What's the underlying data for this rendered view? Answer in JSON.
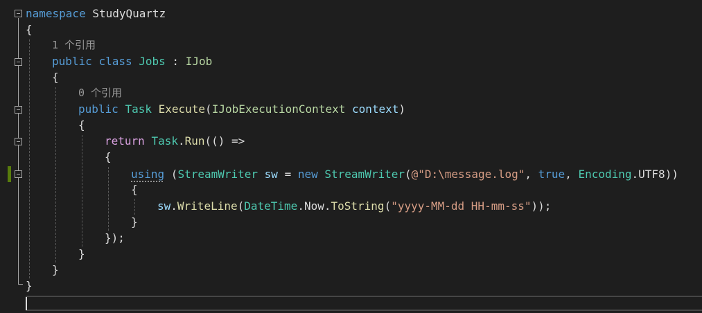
{
  "editor": {
    "language": "C#",
    "colors": {
      "background": "#1e1e1e",
      "keyword": "#569cd6",
      "control_keyword": "#d8a0df",
      "type": "#4ec9b0",
      "interface": "#b8d7a3",
      "method": "#dcdcaa",
      "parameter": "#9cdcfe",
      "string": "#d69d85",
      "codelens": "#999999",
      "change_marker": "#587c0c"
    },
    "lines": {
      "l1": {
        "kw": "namespace",
        "name": " StudyQuartz"
      },
      "l2": {
        "text": "{"
      },
      "l3": {
        "codelens": "1 个引用"
      },
      "l4": {
        "kw1": "public",
        "kw2": "class",
        "name": "Jobs",
        "sep": " : ",
        "iface": "IJob"
      },
      "l5": {
        "text": "{"
      },
      "l6": {
        "codelens": "0 个引用"
      },
      "l7": {
        "kw": "public",
        "type": "Task",
        "method": "Execute",
        "open": "(",
        "ptype": "IJobExecutionContext",
        "pname": "context",
        "close": ")"
      },
      "l8": {
        "text": "{"
      },
      "l9": {
        "kw": "return",
        "type": "Task",
        "dot": ".",
        "method": "Run",
        "rest": "(() =>"
      },
      "l10": {
        "text": "{"
      },
      "l11": {
        "kw": "using",
        "open": " (",
        "type1": "StreamWriter",
        "var": " sw",
        "eq": " = ",
        "kw_new": "new",
        "type2": "StreamWriter",
        "paren": "(",
        "str": "@\"D:\\message.log\"",
        "comma1": ", ",
        "kw_true": "true",
        "comma2": ", ",
        "type3": "Encoding",
        "prop": ".UTF8",
        "close": "))"
      },
      "l12": {
        "text": "{"
      },
      "l13": {
        "var": "sw",
        "dot1": ".",
        "method1": "WriteLine",
        "p1": "(",
        "type": "DateTime",
        "dot2": ".",
        "prop": "Now",
        "dot3": ".",
        "method2": "ToString",
        "p2": "(",
        "str": "\"yyyy-MM-dd HH-mm-ss\"",
        "end": "));"
      },
      "l14": {
        "text": "}"
      },
      "l15": {
        "text": "});"
      },
      "l16": {
        "text": "}"
      },
      "l17": {
        "text": "}"
      },
      "l18": {
        "text": "}"
      }
    }
  }
}
